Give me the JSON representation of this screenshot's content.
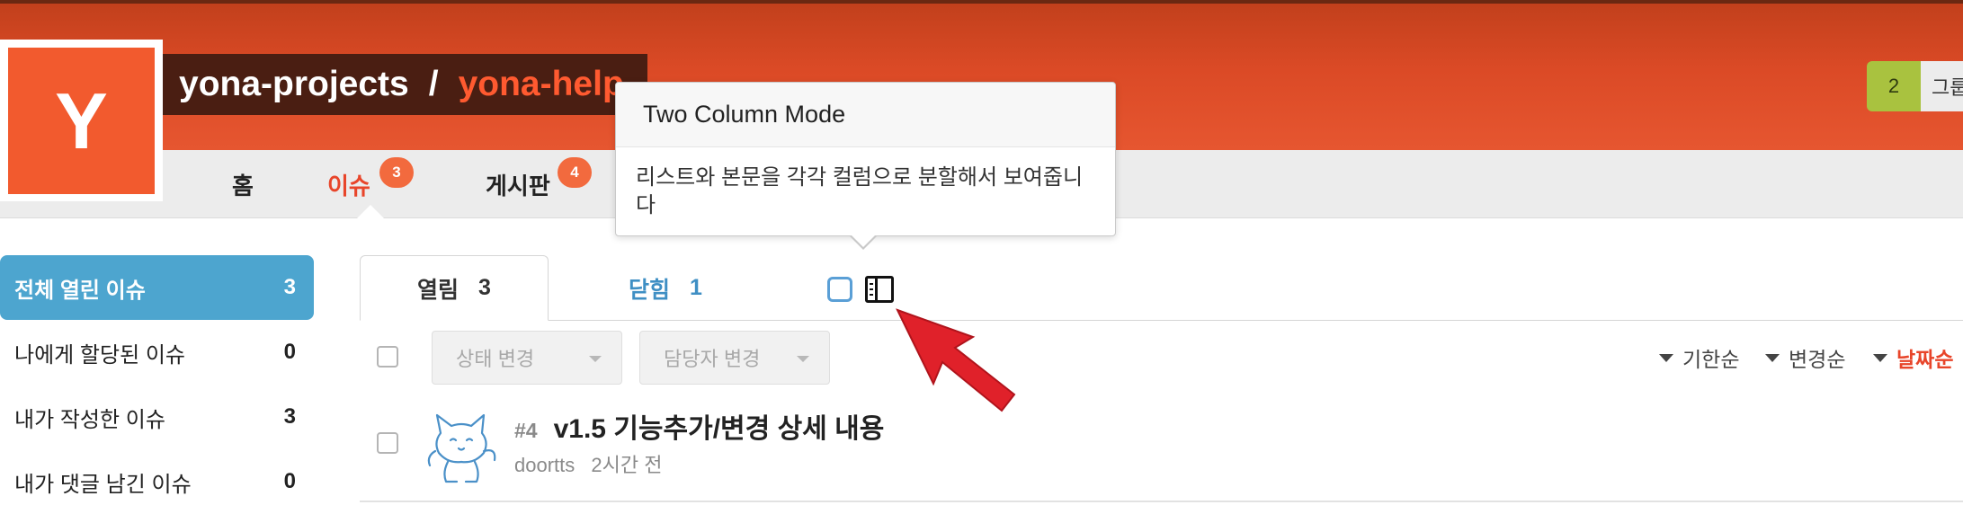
{
  "header": {
    "owner": "yona-projects",
    "separator": "/",
    "repo": "yona-help",
    "logo_letter": "Y",
    "counter_count": "2",
    "counter_label": "그룹"
  },
  "nav": {
    "items": [
      {
        "label": "홈",
        "badge": null
      },
      {
        "label": "이슈",
        "badge": "3"
      },
      {
        "label": "게시판",
        "badge": "4"
      }
    ]
  },
  "sidebar": {
    "items": [
      {
        "label": "전체 열린 이슈",
        "count": "3"
      },
      {
        "label": "나에게 할당된 이슈",
        "count": "0"
      },
      {
        "label": "내가 작성한 이슈",
        "count": "3"
      },
      {
        "label": "내가 댓글 남긴 이슈",
        "count": "0"
      }
    ]
  },
  "tabs": {
    "open_label": "열림",
    "open_count": "3",
    "closed_label": "닫힘",
    "closed_count": "1"
  },
  "toolbar": {
    "state_change": "상태 변경",
    "assignee_change": "담당자 변경",
    "sort": [
      "기한순",
      "변경순",
      "날짜순"
    ]
  },
  "issues": [
    {
      "number": "#4",
      "title": "v1.5 기능추가/변경 상세 내용",
      "author": "doortts",
      "time": "2시간 전"
    }
  ],
  "tooltip": {
    "title": "Two Column Mode",
    "body": "리스트와 본문을 각각 컬럼으로 분할해서 보여줍니다"
  },
  "colors": {
    "header": "#db4a26",
    "accent": "#e8452a",
    "sidebar_active": "#4da5cf",
    "badge": "#f26a3e"
  }
}
